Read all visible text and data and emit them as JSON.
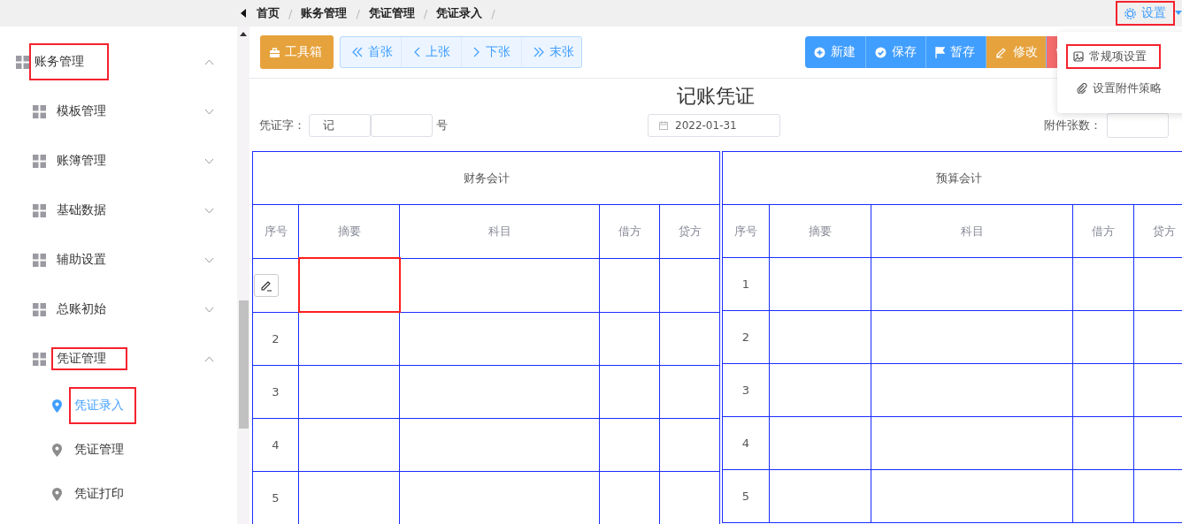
{
  "topbar": {
    "breadcrumb": [
      {
        "label": "首页",
        "separator": "/"
      },
      {
        "label": "账务管理",
        "separator": "/"
      },
      {
        "label": "凭证管理",
        "separator": "/"
      },
      {
        "label": "凭证录入",
        "separator": "/"
      }
    ],
    "settings_label": "设置",
    "settings_highlighted": true
  },
  "sidebar": {
    "items": [
      {
        "label": "账务管理",
        "expanded": true,
        "highlighted": true,
        "children": [
          {
            "label": "模板管理",
            "expanded": false,
            "highlighted": false
          },
          {
            "label": "账簿管理",
            "expanded": false,
            "highlighted": false
          },
          {
            "label": "基础数据",
            "expanded": false,
            "highlighted": false
          },
          {
            "label": "辅助设置",
            "expanded": false,
            "highlighted": false
          },
          {
            "label": "总账初始",
            "expanded": false,
            "highlighted": false
          },
          {
            "label": "凭证管理",
            "expanded": true,
            "highlighted": true,
            "children": [
              {
                "label": "凭证录入",
                "selected": true,
                "highlighted": true
              },
              {
                "label": "凭证管理",
                "selected": false,
                "highlighted": false
              },
              {
                "label": "凭证打印",
                "selected": false,
                "highlighted": false
              }
            ]
          }
        ]
      }
    ]
  },
  "toolbar": {
    "toolbox": "工具箱",
    "nav": [
      {
        "label": "首张"
      },
      {
        "label": "上张"
      },
      {
        "label": "下张"
      },
      {
        "label": "末张"
      }
    ],
    "actions": [
      {
        "label": "新建",
        "kind": "primary"
      },
      {
        "label": "保存",
        "kind": "primary"
      },
      {
        "label": "暂存",
        "kind": "primary"
      },
      {
        "label": "修改",
        "kind": "warning"
      },
      {
        "kind": "danger"
      }
    ]
  },
  "settings_menu": {
    "items": [
      {
        "label": "常规项设置",
        "highlighted": true
      },
      {
        "label": "设置附件策略",
        "highlighted": false
      }
    ]
  },
  "voucher": {
    "title": "记账凭证",
    "word_label": "凭证字：",
    "word_value": "记",
    "number_suffix": "号",
    "date": "2022-01-31",
    "attachments_label": "附件张数："
  },
  "table": {
    "sections": [
      {
        "title": "财务会计",
        "columns": [
          "序号",
          "摘要",
          "科目",
          "借方",
          "贷方"
        ],
        "rows": [
          {
            "kind": "edit",
            "summary_focused": true
          },
          {
            "kind": "number",
            "number": "2",
            "summary_focused": false
          },
          {
            "kind": "number",
            "number": "3",
            "summary_focused": false
          },
          {
            "kind": "number",
            "number": "4",
            "summary_focused": false
          },
          {
            "kind": "number",
            "number": "5",
            "summary_focused": false
          }
        ]
      },
      {
        "title": "预算会计",
        "columns": [
          "序号",
          "摘要",
          "科目",
          "借方",
          "贷方"
        ],
        "rows": [
          {
            "kind": "number",
            "number": "1",
            "summary_focused": false
          },
          {
            "kind": "number",
            "number": "2",
            "summary_focused": false
          },
          {
            "kind": "number",
            "number": "3",
            "summary_focused": false
          },
          {
            "kind": "number",
            "number": "4",
            "summary_focused": false
          },
          {
            "kind": "number",
            "number": "5",
            "summary_focused": false
          }
        ]
      }
    ]
  }
}
